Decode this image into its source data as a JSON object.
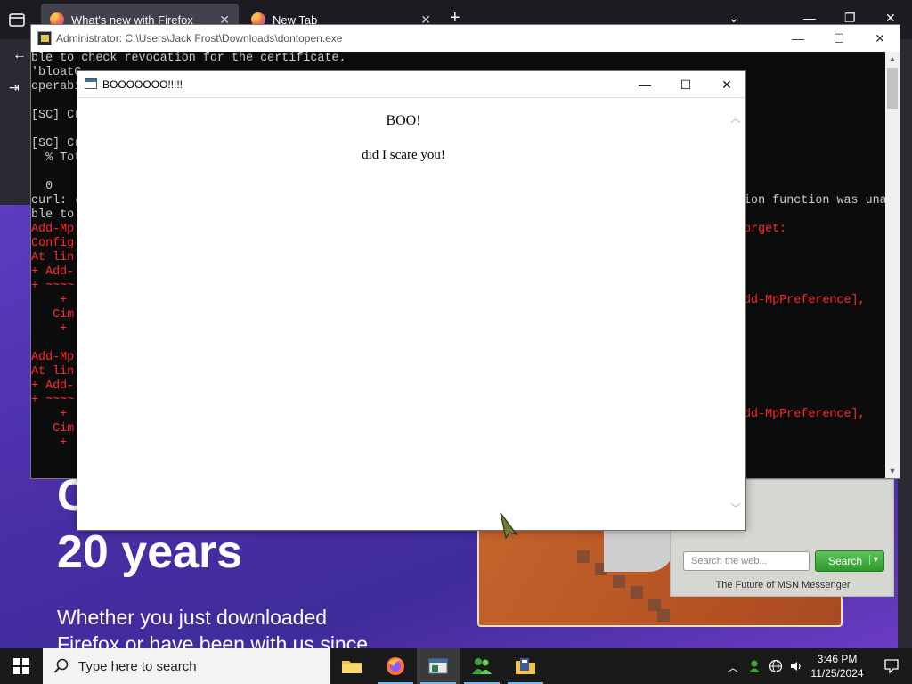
{
  "firefox": {
    "tabs": [
      {
        "title": "What's new with Firefox",
        "active": true
      },
      {
        "title": "New Tab",
        "active": false
      }
    ],
    "hero_line_1": "C",
    "hero_line_2": "20 years",
    "subtitle_line_1": "Whether you just downloaded",
    "subtitle_line_2": "Firefox or have been with us since",
    "msn": {
      "search_placeholder": "Search the web...",
      "search_button": "Search",
      "caption": "The Future of MSN Messenger"
    }
  },
  "console": {
    "title": "Administrator: C:\\Users\\Jack Frost\\Downloads\\dontopen.exe",
    "lines": [
      {
        "text": "ble to check revocation for the certificate.",
        "color": "white",
        "row": 0
      },
      {
        "text": "'bloatC",
        "color": "white",
        "row": 1
      },
      {
        "text": "operabi",
        "color": "white",
        "row": 2
      },
      {
        "text": "[SC] Cr",
        "color": "white",
        "row": 4
      },
      {
        "text": "[SC] Cr",
        "color": "white",
        "row": 6
      },
      {
        "text": "  % Tot",
        "color": "white",
        "row": 7
      },
      {
        "text": "  0",
        "color": "white",
        "row": 9
      },
      {
        "text": "curl: (",
        "color": "white",
        "row": 10
      },
      {
        "text": "ble to",
        "color": "white",
        "row": 11
      },
      {
        "text": "Add-Mp",
        "color": "red",
        "row": 12
      },
      {
        "text": "Config",
        "color": "red",
        "row": 13
      },
      {
        "text": "At lin",
        "color": "red",
        "row": 14
      },
      {
        "text": "+ Add-",
        "color": "red",
        "row": 15
      },
      {
        "text": "+ ~~~~",
        "color": "red",
        "row": 16
      },
      {
        "text": "    + ",
        "color": "red",
        "row": 17
      },
      {
        "text": "   Cim",
        "color": "red",
        "row": 18
      },
      {
        "text": "    + ",
        "color": "red",
        "row": 19
      },
      {
        "text": "Add-Mp",
        "color": "red",
        "row": 21
      },
      {
        "text": "At lin",
        "color": "red",
        "row": 22
      },
      {
        "text": "+ Add-",
        "color": "red",
        "row": 23
      },
      {
        "text": "+ ~~~~",
        "color": "red",
        "row": 24
      },
      {
        "text": "    + ",
        "color": "red",
        "row": 25
      },
      {
        "text": "   Cim",
        "color": "red",
        "row": 26
      },
      {
        "text": "    + ",
        "color": "red",
        "row": 27
      }
    ],
    "right_fragments": [
      {
        "text": "ion function was una",
        "color": "white",
        "row": 10
      },
      {
        "text": "orget:",
        "color": "red",
        "row": 12
      },
      {
        "text": "dd-MpPreference],",
        "color": "red",
        "row": 17
      },
      {
        "text": "dd-MpPreference],",
        "color": "red",
        "row": 25
      }
    ]
  },
  "dialog": {
    "title": "BOOOOOOO!!!!!",
    "heading": "BOO!",
    "message": "did I scare you!"
  },
  "taskbar": {
    "search_placeholder": "Type here to search",
    "apps": [
      "file-explorer",
      "firefox",
      "console-app",
      "msn-messenger",
      "downloads-folder"
    ],
    "time": "3:46 PM",
    "date": "11/25/2024"
  },
  "colors": {
    "console_bg": "#0c0c0c",
    "console_error": "#ff2b2b",
    "firefox_purple": "#4a2fa8",
    "msn_green": "#2c9a2a"
  }
}
